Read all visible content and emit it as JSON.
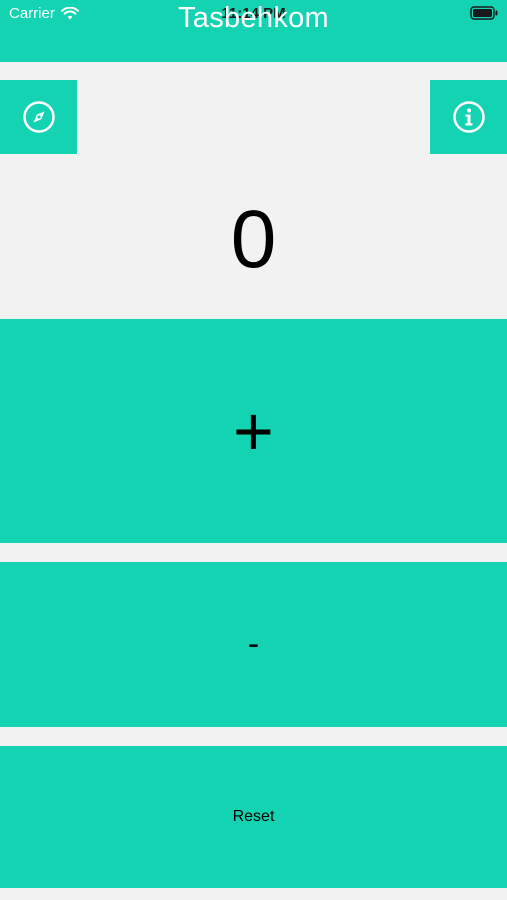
{
  "status_bar": {
    "carrier": "Carrier",
    "time": "11:14 PM"
  },
  "app": {
    "title": "Tasbehkom"
  },
  "toolbar": {
    "left_icon": "compass-icon",
    "right_icon": "info-icon"
  },
  "counter": {
    "value": "0"
  },
  "actions": {
    "increment_label": "+",
    "decrement_label": "-",
    "reset_label": "Reset"
  },
  "colors": {
    "accent": "#14d3b2",
    "background": "#f2f2f2",
    "text": "#000000",
    "header_text": "#ffffff"
  }
}
